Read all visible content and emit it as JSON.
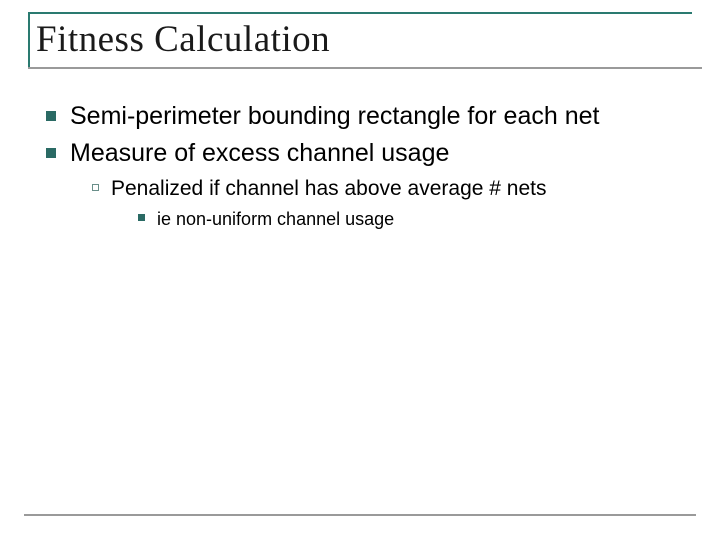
{
  "title": "Fitness Calculation",
  "bullets": {
    "lvl1": [
      "Semi-perimeter bounding rectangle for each net",
      "Measure of excess channel usage"
    ],
    "lvl2": [
      "Penalized if channel has above average # nets"
    ],
    "lvl3": [
      "ie non-uniform channel usage"
    ]
  }
}
